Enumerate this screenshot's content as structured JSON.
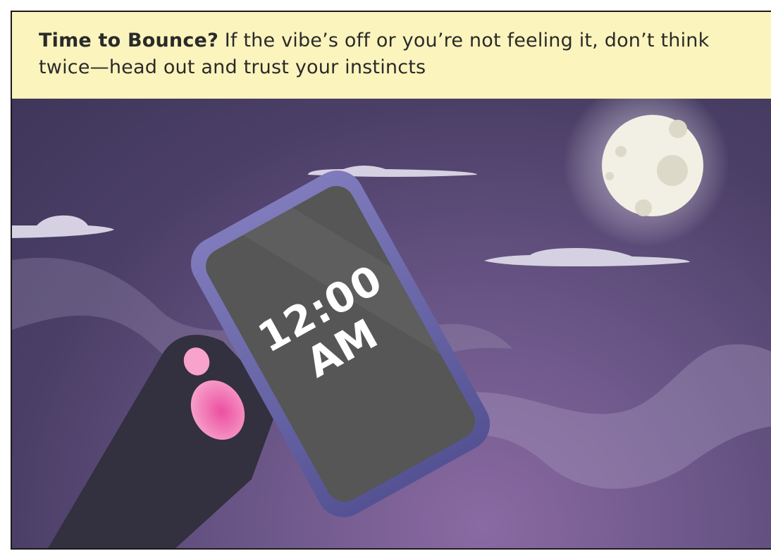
{
  "caption": {
    "lead": "Time to Bounce?",
    "body": " If the vibe’s off or you’re not feeling it, don’t think twice—head out and trust your instincts"
  },
  "phone": {
    "time": "12:00",
    "period": "AM"
  },
  "colors": {
    "caption_bg": "#fbf4bd",
    "sky_dark": "#3f365a",
    "sky_glow": "#8a6aa2",
    "phone_frame": "#6e6aa8",
    "phone_screen": "#555655",
    "moon": "#f2f0e4",
    "finger": "#ee7fb5"
  },
  "icons": [
    "moon-icon",
    "cloud-icon",
    "phone-icon",
    "hand-icon"
  ]
}
